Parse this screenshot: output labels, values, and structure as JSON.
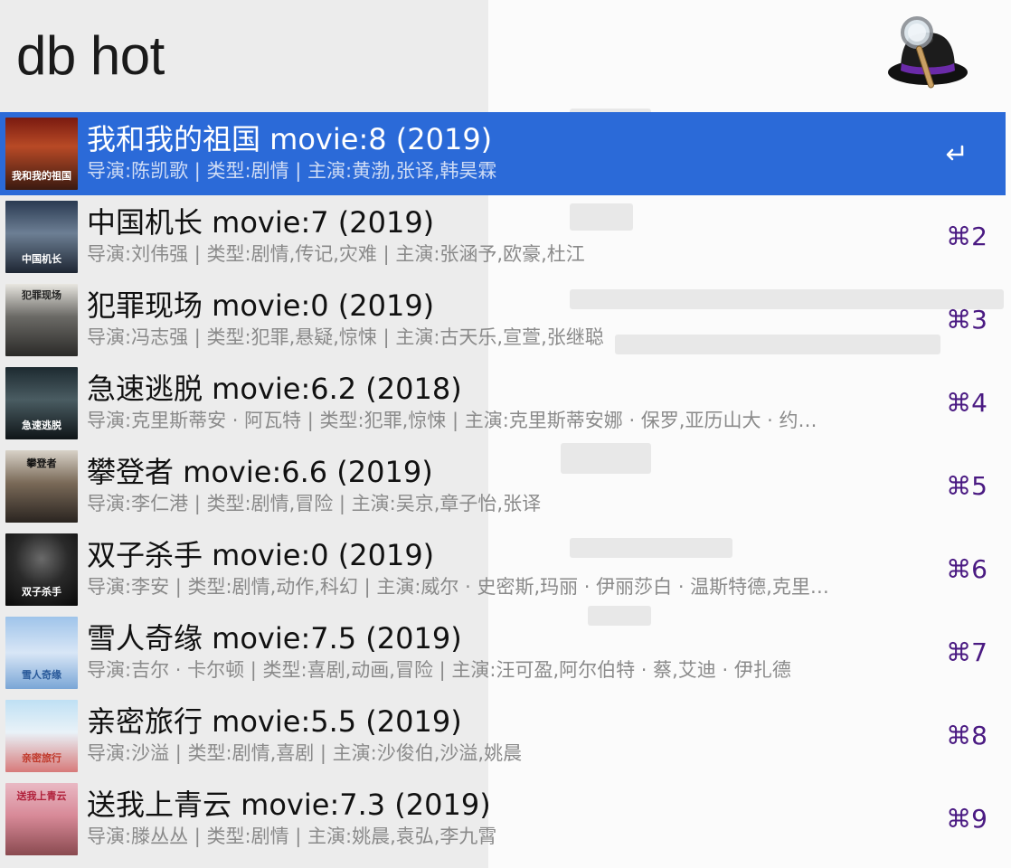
{
  "search": {
    "query": "db hot"
  },
  "app": {
    "logo_icon": "alfred-hat-magnifier-icon"
  },
  "colors": {
    "selection": "#2b6ad8",
    "shortcut": "#4a1a82"
  },
  "results": [
    {
      "title": "我和我的祖国 movie:8 (2019)",
      "subtitle": "导演:陈凯歌 | 类型:剧情 | 主演:黄渤,张译,韩昊霖",
      "shortcut": "",
      "selected": true,
      "thumb_text": "我和我的祖国"
    },
    {
      "title": "中国机长 movie:7 (2019)",
      "subtitle": "导演:刘伟强 | 类型:剧情,传记,灾难 | 主演:张涵予,欧豪,杜江",
      "shortcut": "⌘2",
      "thumb_text": "中国机长"
    },
    {
      "title": "犯罪现场 movie:0 (2019)",
      "subtitle": "导演:冯志强 | 类型:犯罪,悬疑,惊悚 | 主演:古天乐,宣萱,张继聪",
      "shortcut": "⌘3",
      "thumb_text": "犯罪现场"
    },
    {
      "title": "急速逃脱 movie:6.2 (2018)",
      "subtitle": "导演:克里斯蒂安 · 阿瓦特 | 类型:犯罪,惊悚 | 主演:克里斯蒂安娜 · 保罗,亚历山大 · 约…",
      "shortcut": "⌘4",
      "thumb_text": "急速逃脱"
    },
    {
      "title": "攀登者 movie:6.6 (2019)",
      "subtitle": "导演:李仁港 | 类型:剧情,冒险 | 主演:吴京,章子怡,张译",
      "shortcut": "⌘5",
      "thumb_text": "攀登者"
    },
    {
      "title": "双子杀手 movie:0 (2019)",
      "subtitle": "导演:李安 | 类型:剧情,动作,科幻 | 主演:威尔 · 史密斯,玛丽 · 伊丽莎白 · 温斯特德,克里…",
      "shortcut": "⌘6",
      "thumb_text": "双子杀手"
    },
    {
      "title": "雪人奇缘 movie:7.5 (2019)",
      "subtitle": "导演:吉尔 · 卡尔顿 | 类型:喜剧,动画,冒险 | 主演:汪可盈,阿尔伯特 · 蔡,艾迪 · 伊扎德",
      "shortcut": "⌘7",
      "thumb_text": "雪人奇缘"
    },
    {
      "title": "亲密旅行 movie:5.5 (2019)",
      "subtitle": "导演:沙溢 | 类型:剧情,喜剧 | 主演:沙俊伯,沙溢,姚晨",
      "shortcut": "⌘8",
      "thumb_text": "亲密旅行"
    },
    {
      "title": "送我上青云 movie:7.3 (2019)",
      "subtitle": "导演:滕丛丛 | 类型:剧情 | 主演:姚晨,袁弘,李九霄",
      "shortcut": "⌘9",
      "thumb_text": "送我上青云"
    }
  ]
}
